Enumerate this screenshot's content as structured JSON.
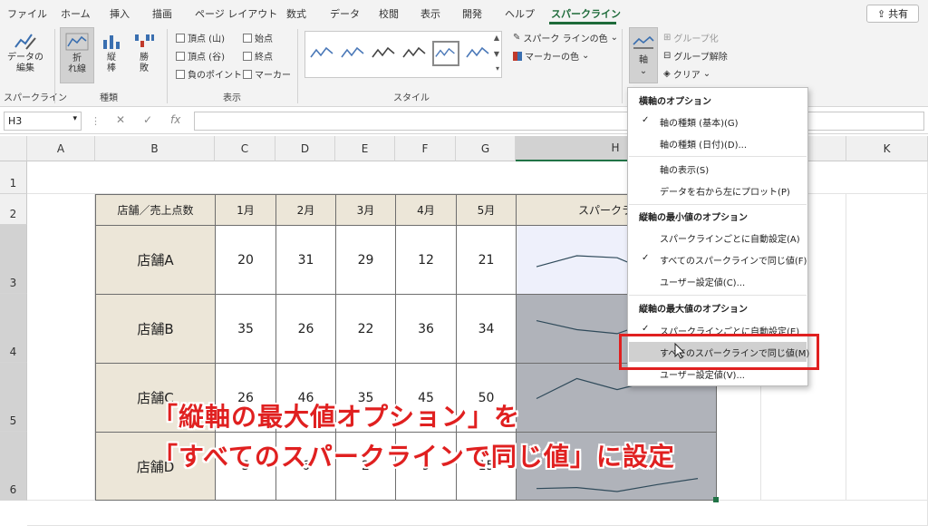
{
  "menu_tabs": [
    "ファイル",
    "ホーム",
    "挿入",
    "描画",
    "ページ レイアウト",
    "数式",
    "データ",
    "校閲",
    "表示",
    "開発",
    "ヘルプ",
    "スパークライン"
  ],
  "active_tab": "スパークライン",
  "share_label": "共有",
  "ribbon": {
    "edit_data_label": "データの\n編集",
    "group_sparkline": "スパークライン",
    "type_line": "折\nれ線",
    "type_column": "縦\n棒",
    "type_winloss": "勝\n敗",
    "group_type": "種類",
    "show": {
      "high_point": "頂点 (山)",
      "low_point": "頂点 (谷)",
      "negative_points": "負のポイント",
      "first_point": "始点",
      "last_point": "終点",
      "markers": "マーカー"
    },
    "group_show": "表示",
    "group_style": "スタイル",
    "sparkline_color": "スパーク ラインの色",
    "marker_color": "マーカーの色",
    "axis_label": "軸",
    "group_label": "グループ化",
    "ungroup_label": "グループ解除",
    "clear_label": "クリア"
  },
  "formula_bar": {
    "cell_ref": "H3",
    "fx": "fx",
    "value": ""
  },
  "columns": [
    "A",
    "B",
    "C",
    "D",
    "E",
    "F",
    "G",
    "H",
    "I",
    "J",
    "K"
  ],
  "rows": [
    "1",
    "2",
    "3",
    "4",
    "5",
    "6"
  ],
  "table": {
    "corner_header": "店舗／売上点数",
    "months": [
      "1月",
      "2月",
      "3月",
      "4月",
      "5月"
    ],
    "sparkline_header": "スパークライン",
    "stores": [
      {
        "name": "店舗A",
        "values": [
          "20",
          "31",
          "29",
          "12",
          "21"
        ]
      },
      {
        "name": "店舗B",
        "values": [
          "35",
          "26",
          "22",
          "36",
          "34"
        ]
      },
      {
        "name": "店舗C",
        "values": [
          "26",
          "46",
          "35",
          "45",
          "50"
        ]
      },
      {
        "name": "店舗D",
        "values": [
          "5",
          "6",
          "2",
          "9",
          "15"
        ]
      }
    ]
  },
  "axis_menu": {
    "h_header": "横軸のオプション",
    "h_items": [
      {
        "label": "軸の種類 (基本)(G)",
        "checked": true
      },
      {
        "label": "軸の種類 (日付)(D)...",
        "checked": false
      },
      {
        "label": "軸の表示(S)",
        "checked": false
      },
      {
        "label": "データを右から左にプロット(P)",
        "checked": false
      }
    ],
    "min_header": "縦軸の最小値のオプション",
    "min_items": [
      {
        "label": "スパークラインごとに自動設定(A)",
        "checked": false
      },
      {
        "label": "すべてのスパークラインで同じ値(F)",
        "checked": true
      },
      {
        "label": "ユーザー設定値(C)...",
        "checked": false
      }
    ],
    "max_header": "縦軸の最大値のオプション",
    "max_items": [
      {
        "label": "スパークラインごとに自動設定(E)",
        "checked": true
      },
      {
        "label": "すべてのスパークラインで同じ値(M)",
        "checked": false
      },
      {
        "label": "ユーザー設定値(V)...",
        "checked": false
      }
    ]
  },
  "annotation": {
    "line1": "「縦軸の最大値オプション」を",
    "line2": "「すべてのスパークラインで同じ値」に設定"
  },
  "colors": {
    "accent_green": "#1e6b3a",
    "highlight_red": "#e02020",
    "header_fill": "#ece6d8",
    "selected_fill": "#b0b3ba"
  }
}
